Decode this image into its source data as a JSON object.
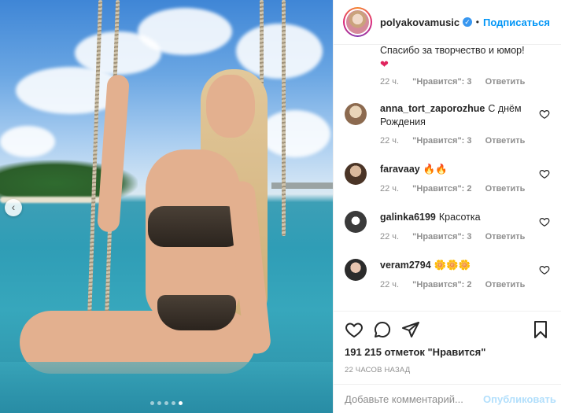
{
  "post": {
    "image_description_icon": "photo",
    "carousel": {
      "slides": 5,
      "active": 4
    }
  },
  "header": {
    "username": "polyakovamusic",
    "verified": true,
    "separator": "•",
    "follow_label": "Подписаться"
  },
  "comments": [
    {
      "username": "",
      "text": "Спасибо за творчество и юмор!",
      "emoji": "❤",
      "time": "22 ч.",
      "likes": "\"Нравится\": 3",
      "reply": "Ответить"
    },
    {
      "username": "anna_tort_zaporozhue",
      "text": "С днём Рождения",
      "time": "22 ч.",
      "likes": "\"Нравится\": 3",
      "reply": "Ответить"
    },
    {
      "username": "faravaay",
      "text": "🔥🔥",
      "time": "22 ч.",
      "likes": "\"Нравится\": 2",
      "reply": "Ответить"
    },
    {
      "username": "galinka6199",
      "text": "Красотка",
      "time": "22 ч.",
      "likes": "\"Нравится\": 3",
      "reply": "Ответить"
    },
    {
      "username": "veram2794",
      "text": "🌼🌼🌼",
      "time": "22 ч.",
      "likes": "\"Нравится\": 2",
      "reply": "Ответить"
    }
  ],
  "actions": {
    "likes_text": "191 215 отметок \"Нравится\"",
    "time_ago": "22 ЧАСОВ НАЗАД"
  },
  "add_comment": {
    "placeholder": "Добавьте комментарий...",
    "publish_label": "Опубликовать"
  },
  "colors": {
    "accent": "#0095f6",
    "publish_disabled": "#b2dffc",
    "muted": "#8e8e8e",
    "verified": "#3897f0"
  }
}
